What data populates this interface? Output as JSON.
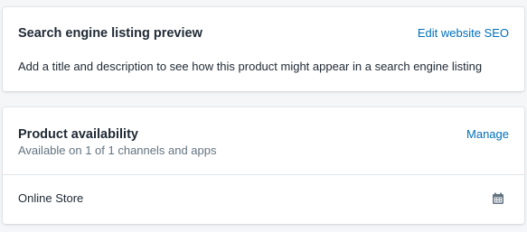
{
  "seo_card": {
    "title": "Search engine listing preview",
    "edit_link": "Edit website SEO",
    "description": "Add a title and description to see how this product might appear in a search engine listing"
  },
  "availability_card": {
    "title": "Product availability",
    "manage_link": "Manage",
    "subtitle": "Available on 1 of 1 channels and apps",
    "channels": [
      {
        "label": "Online Store",
        "icon": "calendar-icon"
      }
    ]
  },
  "colors": {
    "link": "#006fbb",
    "text": "#212b36",
    "subdued": "#637381",
    "background": "#f4f6f8",
    "icon": "#637381"
  }
}
